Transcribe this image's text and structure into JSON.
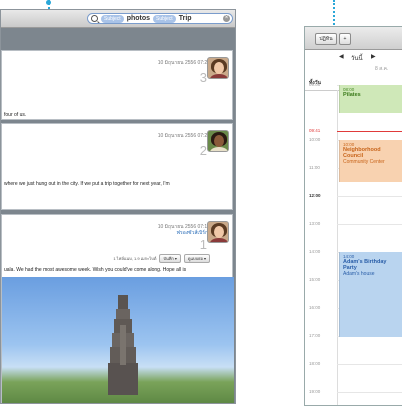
{
  "search": {
    "field_kind": "Subject",
    "terms": [
      {
        "kind": "Subject",
        "text": "photos"
      },
      {
        "kind": "Subject",
        "text": "Trip"
      }
    ]
  },
  "messages": [
    {
      "date": "10 มิถุนายน 2556 07:24",
      "count": "3",
      "text": "four of us."
    },
    {
      "date": "10 มิถุนายน 2556 07:23",
      "count": "2",
      "text": "where we just hung out in the city. If we put a trip together for next year, I'm"
    },
    {
      "date": "10 มิถุนายน 2556 07:17",
      "count": "1",
      "sender": "ฟรองซัวส์เบิร์ก",
      "text": "uala. We had the most awesome week. Wish you could've come along. Hope all is",
      "attachment": {
        "info": "1 ไฟล์แนบ, 1.9 เมกะไบต์",
        "save": "บันทึก ▾",
        "quicklook": "ดูแบบย่อ ▾"
      }
    }
  ],
  "colors": {
    "accent": "#2aa7d8",
    "pilates": "#cfe8b8",
    "council": "#f8d2b0",
    "party": "#b9d4ef"
  },
  "calendar": {
    "toolbar": {
      "calendars": "ปฏิทิน",
      "add": "+"
    },
    "nav": {
      "prev": "◀",
      "today": "วันนี้",
      "next": "▶"
    },
    "sub": "8 ส.ค.",
    "allday": "ทั้งวัน",
    "now": "09:41",
    "hours": [
      "09:00",
      "10:00",
      "11:00",
      "12:00",
      "13:00",
      "14:00",
      "15:00",
      "16:00",
      "17:00",
      "18:00",
      "19:00"
    ],
    "events": [
      {
        "time": "08:00",
        "name": "Pilates",
        "location": ""
      },
      {
        "time": "10:00",
        "name": "Neighborhood Council",
        "location": "Community Center"
      },
      {
        "time": "14:00",
        "name": "Adam's Birthday Party",
        "location": "Adam's house"
      }
    ]
  }
}
